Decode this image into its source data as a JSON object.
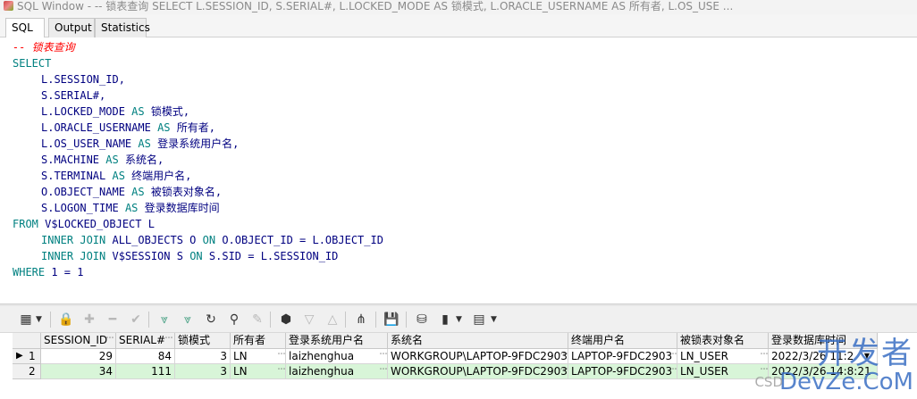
{
  "window": {
    "title": "SQL Window - -- 锁表查询 SELECT L.SESSION_ID, S.SERIAL#, L.LOCKED_MODE AS 锁模式, L.ORACLE_USERNAME AS 所有者, L.OS_USE ..."
  },
  "tabs": [
    {
      "label": "SQL",
      "active": true
    },
    {
      "label": "Output",
      "active": false
    },
    {
      "label": "Statistics",
      "active": false
    }
  ],
  "sql": {
    "comment": "-- 锁表查询",
    "select": "SELECT",
    "cols": [
      {
        "expr": "L.SESSION_ID,",
        "as": "",
        "alias": ""
      },
      {
        "expr": "S.SERIAL#,",
        "as": "",
        "alias": ""
      },
      {
        "expr": "L.LOCKED_MODE",
        "as": "AS",
        "alias": "锁模式,"
      },
      {
        "expr": "L.ORACLE_USERNAME",
        "as": "AS",
        "alias": "所有者,"
      },
      {
        "expr": "L.OS_USER_NAME",
        "as": "AS",
        "alias": "登录系统用户名,"
      },
      {
        "expr": "S.MACHINE",
        "as": "AS",
        "alias": "系统名,"
      },
      {
        "expr": "S.TERMINAL",
        "as": "AS",
        "alias": "终端用户名,"
      },
      {
        "expr": "O.OBJECT_NAME",
        "as": "AS",
        "alias": "被锁表对象名,"
      },
      {
        "expr": "S.LOGON_TIME",
        "as": "AS",
        "alias": "登录数据库时间"
      }
    ],
    "from_kw": "FROM",
    "from_table": "V$LOCKED_OBJECT L",
    "join1_kw1": "INNER JOIN",
    "join1_table": "ALL_OBJECTS O",
    "join1_on": "ON",
    "join1_cond": "O.OBJECT_ID = L.OBJECT_ID",
    "join2_kw1": "INNER JOIN",
    "join2_table": "V$SESSION S",
    "join2_on": "ON",
    "join2_cond": "S.SID = L.SESSION_ID",
    "where_kw": "WHERE",
    "where_cond": "1 = 1"
  },
  "toolbar": {
    "icons": [
      "grid-view-icon",
      "lock-icon",
      "add-record-icon",
      "delete-record-icon",
      "post-record-icon",
      "filter-icon",
      "clear-filter-icon",
      "refresh-icon",
      "find-icon",
      "clear-icon",
      "query-by-example-icon",
      "sort-desc-icon",
      "sort-asc-icon",
      "hierarchy-icon",
      "save-icon",
      "export-icon",
      "chart-icon",
      "table-export-icon"
    ]
  },
  "results": {
    "columns": [
      "SESSION_ID",
      "SERIAL#",
      "锁模式",
      "所有者",
      "登录系统用户名",
      "系统名",
      "终端用户名",
      "被锁表对象名",
      "登录数据库时间"
    ],
    "rows": [
      {
        "row_no": "1",
        "marker": "▶",
        "session_id": "29",
        "serial": "84",
        "lock_mode": "3",
        "owner": "LN",
        "os_user": "laizhenghua",
        "machine": "WORKGROUP\\LAPTOP-9FDC2903",
        "terminal": "LAPTOP-9FDC2903",
        "object": "LN_USER",
        "logon_time": "2022/3/26 11:2"
      },
      {
        "row_no": "2",
        "marker": "",
        "session_id": "34",
        "serial": "111",
        "lock_mode": "3",
        "owner": "LN",
        "os_user": "laizhenghua",
        "machine": "WORKGROUP\\LAPTOP-9FDC2903",
        "terminal": "LAPTOP-9FDC2903",
        "object": "LN_USER",
        "logon_time": "2022/3/26 14:8:21"
      }
    ]
  },
  "watermark": {
    "cn": "开发者",
    "en": "DevZe.CoM",
    "small": "CSD"
  }
}
